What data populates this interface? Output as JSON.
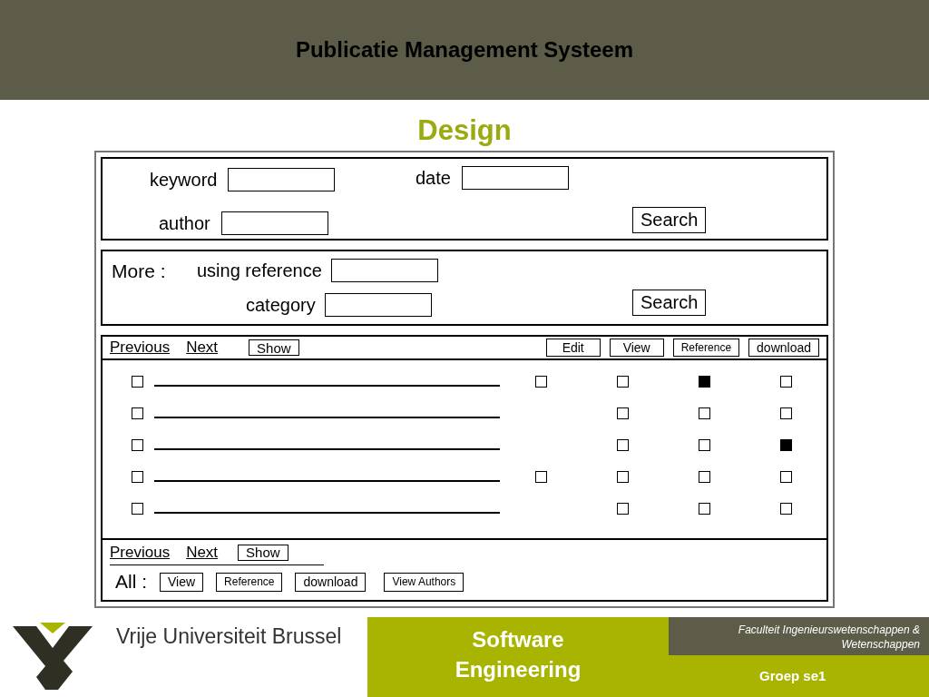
{
  "header": {
    "title": "Publicatie Management Systeem"
  },
  "slide_title": "Design",
  "search_panel": {
    "fields": [
      {
        "label": "keyword"
      },
      {
        "label": "date"
      },
      {
        "label": "author"
      }
    ],
    "button": "Search"
  },
  "more_panel": {
    "heading": "More :",
    "fields": [
      {
        "label": "using reference"
      },
      {
        "label": "category"
      }
    ],
    "button": "Search"
  },
  "results": {
    "top_nav": [
      "Previous",
      "Next"
    ],
    "show_button": "Show",
    "columns": [
      "Edit",
      "View",
      "Reference",
      "download"
    ],
    "rows": [
      {
        "selected": false,
        "edit_checked": false,
        "view_checked": false,
        "reference_checked": true,
        "download_checked": false
      },
      {
        "selected": false,
        "view_checked": false,
        "reference_checked": false,
        "download_checked": false
      },
      {
        "selected": false,
        "view_checked": false,
        "reference_checked": false,
        "download_checked": true
      },
      {
        "selected": false,
        "edit_checked": false,
        "view_checked": false,
        "reference_checked": false,
        "download_checked": false
      },
      {
        "selected": false,
        "view_checked": false,
        "reference_checked": false,
        "download_checked": false
      }
    ],
    "bottom_nav": [
      "Previous",
      "Next"
    ],
    "bottom_show_button": "Show",
    "all_label": "All :",
    "all_buttons": [
      "View",
      "Reference",
      "download",
      "View Authors"
    ]
  },
  "footer": {
    "university": "Vrije Universiteit Brussel",
    "course": [
      "Software",
      "Engineering"
    ],
    "faculty": "Faculteit Ingenieurswetenschappen & Wetenschappen",
    "group": "Groep se1"
  }
}
